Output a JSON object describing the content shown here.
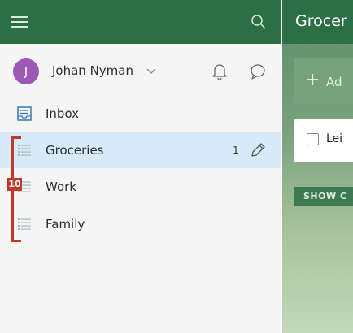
{
  "sidebar": {
    "user": {
      "avatar_initial": "J",
      "name": "Johan Nyman"
    },
    "items": [
      {
        "label": "Inbox",
        "icon": "inbox-icon"
      },
      {
        "label": "Groceries",
        "icon": "list-icon",
        "count": "1",
        "selected": true
      },
      {
        "label": "Work",
        "icon": "list-icon"
      },
      {
        "label": "Family",
        "icon": "list-icon"
      }
    ],
    "annotation": {
      "badge": "10",
      "color": "#c0392b"
    }
  },
  "main": {
    "title": "Grocer",
    "add_placeholder": "Ad",
    "task": {
      "text": "Lei"
    },
    "show_button": "SHOW C"
  },
  "colors": {
    "header": "#2c6e45",
    "selected_row": "#d6ebf7",
    "avatar": "#9b59b6"
  }
}
